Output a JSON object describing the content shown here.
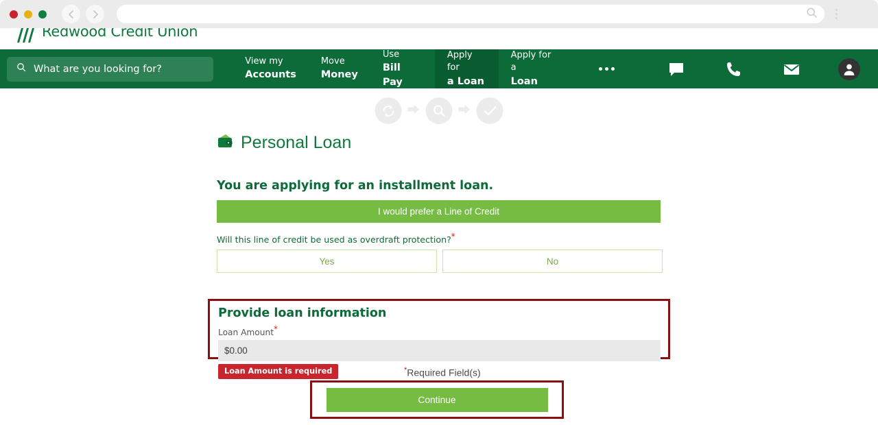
{
  "browser": {
    "traffic_lights": [
      "close",
      "minimize",
      "maximize"
    ],
    "back_icon": "back-arrow-icon",
    "forward_icon": "forward-arrow-icon",
    "url_value": "",
    "url_search_icon": "search-icon",
    "menu_icon": "kebab-menu-icon"
  },
  "site_header": {
    "logo_name": "redwood-credit-union-logo",
    "brand": "Redwood Credit Union",
    "brand_color": "#0f7a3d"
  },
  "navbar": {
    "background": "#0c6b38",
    "active_background": "#095c2f",
    "search": {
      "icon": "search-icon",
      "placeholder": "What are you looking for?",
      "value": ""
    },
    "items": [
      {
        "top": "View my",
        "bottom": "Accounts",
        "active": false
      },
      {
        "top": "Move",
        "bottom": "Money",
        "active": false
      },
      {
        "top": "Use",
        "bottom": "Bill Pay",
        "active": false
      },
      {
        "top": "Apply for",
        "bottom": "a Loan",
        "active": true
      },
      {
        "top": "Apply for a",
        "bottom": "Loan",
        "active": false
      }
    ],
    "more_icon": "ellipsis-icon",
    "icons": [
      {
        "name": "chat-bubble-icon"
      },
      {
        "name": "phone-icon"
      },
      {
        "name": "envelope-icon"
      },
      {
        "name": "user-avatar-icon"
      }
    ]
  },
  "progress": {
    "steps": [
      {
        "icon": "refresh-cycle-icon",
        "state": "inactive"
      },
      {
        "icon": "magnifier-icon",
        "state": "inactive"
      },
      {
        "icon": "checkmark-icon",
        "state": "inactive"
      }
    ],
    "arrow_icon": "right-arrow-icon",
    "color": "#ececec"
  },
  "page": {
    "title_icon": "wallet-icon",
    "title": "Personal Loan",
    "subheading": "You are applying for an installment loan.",
    "line_of_credit_button": "I would prefer a Line of Credit",
    "overdraft_question": "Will this line of credit be used as overdraft protection?",
    "required_marker": "*",
    "yes_label": "Yes",
    "no_label": "No",
    "section": {
      "heading": "Provide loan information",
      "field_label": "Loan Amount",
      "field_value": "$0.00",
      "field_placeholder": "$0.00",
      "highlight_color": "#8b0f10"
    },
    "error_badge": "Loan Amount is required",
    "required_note_star": "*",
    "required_note": "Required Field(s)",
    "continue_label": "Continue",
    "accent_green": "#76bc43",
    "dark_green": "#0c6b38",
    "error_red": "#c9252c"
  }
}
